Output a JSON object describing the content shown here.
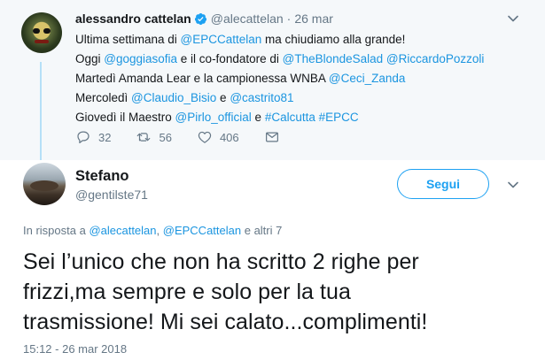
{
  "parent_tweet": {
    "author_name": "alessandro cattelan",
    "handle": "@alecattelan",
    "separator": "·",
    "time": "26 mar",
    "lines": [
      [
        {
          "t": "Ultima settimana di ",
          "link": false
        },
        {
          "t": "@EPCCattelan",
          "link": true
        },
        {
          "t": " ma chiudiamo alla grande!",
          "link": false
        }
      ],
      [
        {
          "t": "Oggi ",
          "link": false
        },
        {
          "t": "@goggiasofia",
          "link": true
        },
        {
          "t": " e il co-fondatore di ",
          "link": false
        },
        {
          "t": "@TheBlondeSalad",
          "link": true
        },
        {
          "t": " ",
          "link": false
        },
        {
          "t": "@RiccardoPozzoli",
          "link": true
        }
      ],
      [
        {
          "t": "Martedì Amanda Lear e la campionessa WNBA ",
          "link": false
        },
        {
          "t": "@Ceci_Zanda",
          "link": true
        }
      ],
      [
        {
          "t": "Mercoledì ",
          "link": false
        },
        {
          "t": "@Claudio_Bisio",
          "link": true
        },
        {
          "t": " e ",
          "link": false
        },
        {
          "t": "@castrito81",
          "link": true
        }
      ],
      [
        {
          "t": "Giovedì il Maestro ",
          "link": false
        },
        {
          "t": "@Pirlo_official",
          "link": true
        },
        {
          "t": " e ",
          "link": false
        },
        {
          "t": "#Calcutta",
          "link": true
        },
        {
          "t": " ",
          "link": false
        },
        {
          "t": "#EPCC",
          "link": true
        }
      ]
    ],
    "actions": {
      "replies": "32",
      "retweets": "56",
      "likes": "406"
    }
  },
  "reply_tweet": {
    "author_name": "Stefano",
    "handle": "@gentilste71",
    "follow_label": "Segui",
    "reply_prefix": "In risposta a ",
    "reply_targets": [
      {
        "t": "@alecattelan",
        "link": true
      },
      {
        "t": ", ",
        "link": false
      },
      {
        "t": "@EPCCattelan",
        "link": true
      },
      {
        "t": " e altri 7",
        "link": false
      }
    ],
    "text_lines": [
      "Sei l’unico che non ha scritto 2 righe per",
      "frizzi,ma sempre e solo per la tua",
      "trasmissione! Mi sei calato...complimenti!"
    ],
    "timestamp": "15:12 - 26 mar 2018"
  },
  "colors": {
    "link": "#1b95e0",
    "follow": "#1da1f2",
    "thread_line": "#b5e0f7",
    "muted": "#657786",
    "parent_bg": "#f5f8fa"
  },
  "icons": [
    "verified-badge-icon",
    "chevron-down-icon",
    "reply-icon",
    "retweet-icon",
    "like-icon",
    "direct-message-icon"
  ]
}
